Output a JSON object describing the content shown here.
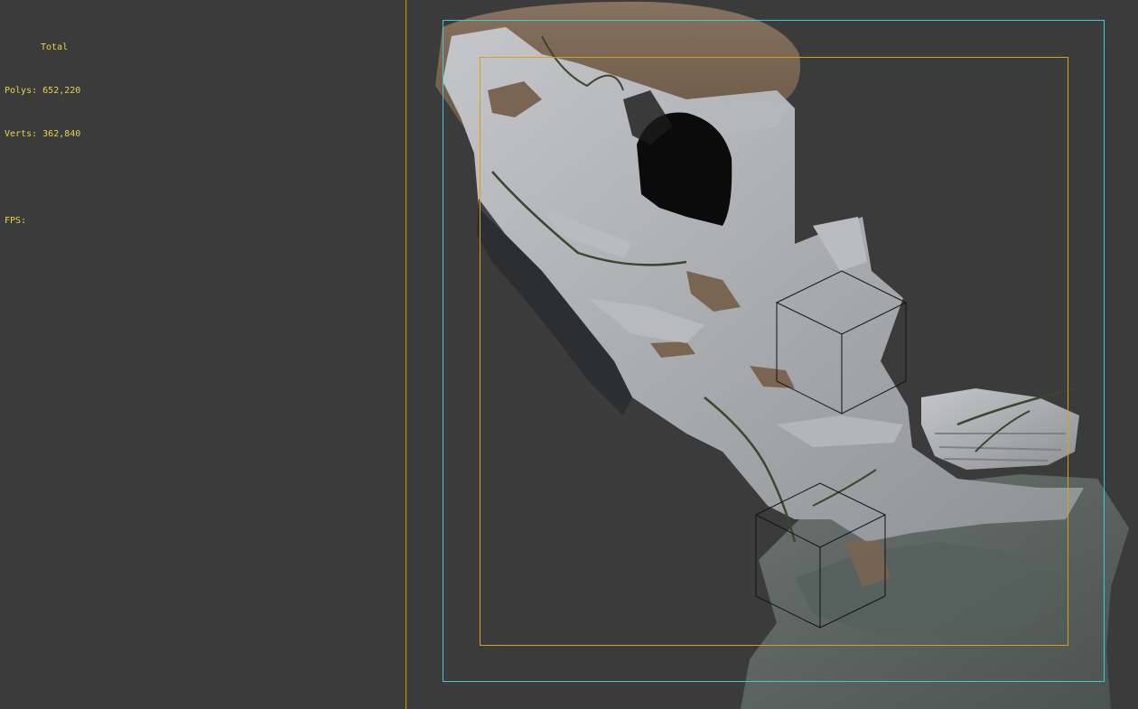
{
  "stats": {
    "title": "Total",
    "polys_label": "Polys:",
    "polys_value": "652,220",
    "verts_label": "Verts:",
    "verts_value": "362,840",
    "fps_label": "FPS:"
  },
  "colors": {
    "viewport_background": "#3b3b3b",
    "stats_text": "#e8d24a",
    "safe_frame_outer": "#3fc9d2",
    "safe_frame_inner": "#d6a019",
    "rock_light": "#a9abae",
    "rock_dark": "#5c6561",
    "dirt": "#7a6552",
    "vine": "#3b4630"
  },
  "scene": {
    "subject": "cliff-rock-model",
    "gizmos": [
      "helper-box",
      "helper-box"
    ]
  }
}
